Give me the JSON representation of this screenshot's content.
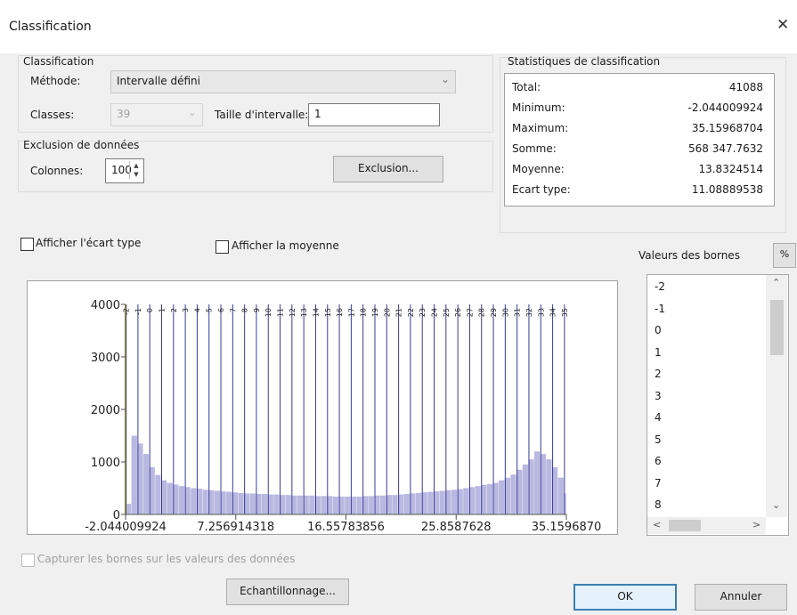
{
  "window": {
    "title": "Classification",
    "close": "✕"
  },
  "classification": {
    "group_label": "Classification",
    "method_label": "Méthode:",
    "method_value": "Intervalle défini",
    "classes_label": "Classes:",
    "classes_value": "39",
    "interval_label": "Taille d'intervalle:",
    "interval_value": "1"
  },
  "exclusion": {
    "group_label": "Exclusion de données",
    "columns_label": "Colonnes:",
    "columns_value": "100",
    "exclusion_button": "Exclusion..."
  },
  "stats": {
    "group_label": "Statistiques de classification",
    "rows": [
      {
        "label": "Total:",
        "value": "41088"
      },
      {
        "label": "Minimum:",
        "value": "-2.044009924"
      },
      {
        "label": "Maximum:",
        "value": "35.15968704"
      },
      {
        "label": "Somme:",
        "value": "568 347.7632"
      },
      {
        "label": "Moyenne:",
        "value": "13.8324514"
      },
      {
        "label": "Ecart type:",
        "value": "11.08889538"
      }
    ]
  },
  "options": {
    "show_std_label": "Afficher l'écart type",
    "show_std_checked": false,
    "show_mean_label": "Afficher la moyenne",
    "show_mean_checked": false,
    "snap_label": "Capturer les bornes sur les valeurs des données",
    "snap_checked": false
  },
  "breaks": {
    "header_label": "Valeurs des bornes",
    "percent_button": "%",
    "values": [
      "-2",
      "-1",
      "0",
      "1",
      "2",
      "3",
      "4",
      "5",
      "6",
      "7",
      "8"
    ]
  },
  "buttons": {
    "sampling": "Echantillonnage...",
    "ok": "OK",
    "cancel": "Annuler"
  },
  "colors": {
    "histogram": "#b8b8e0",
    "break_line": "#3a3a9a",
    "min_line": "#e8e890"
  },
  "chart_data": {
    "type": "bar",
    "title": "",
    "xlabel": "",
    "ylabel": "",
    "ylim": [
      0,
      4000
    ],
    "xlim": [
      -2.044009924,
      35.15968704
    ],
    "y_ticks": [
      "4000",
      "3000",
      "2000",
      "1000",
      "0"
    ],
    "x_ticks": [
      "-2.044009924",
      "7.256914318",
      "16.55783856",
      "25.8587628",
      "35.1596870"
    ],
    "break_values": [
      -2,
      -1,
      0,
      1,
      2,
      3,
      4,
      5,
      6,
      7,
      8,
      9,
      10,
      11,
      12,
      13,
      14,
      15,
      16,
      17,
      18,
      19,
      20,
      21,
      22,
      23,
      24,
      25,
      26,
      27,
      28,
      29,
      30,
      31,
      32,
      33,
      34,
      35
    ],
    "break_labels": [
      "-2",
      "-1",
      "0",
      "1",
      "2",
      "3",
      "4",
      "5",
      "6",
      "7",
      "8",
      "9",
      "10",
      "11",
      "12",
      "13",
      "14",
      "15",
      "16",
      "17",
      "18",
      "19",
      "20",
      "21",
      "22",
      "23",
      "24",
      "25",
      "26",
      "27",
      "28",
      "29",
      "30",
      "31",
      "32",
      "33",
      "34",
      "35"
    ],
    "bin_width": 0.5,
    "bin_counts": [
      200,
      1500,
      1350,
      1150,
      900,
      750,
      650,
      600,
      570,
      540,
      520,
      500,
      490,
      470,
      460,
      450,
      440,
      430,
      420,
      410,
      400,
      400,
      390,
      390,
      380,
      380,
      370,
      370,
      360,
      360,
      360,
      360,
      350,
      350,
      350,
      340,
      340,
      340,
      340,
      340,
      350,
      350,
      360,
      360,
      370,
      370,
      380,
      390,
      400,
      410,
      420,
      430,
      440,
      450,
      460,
      470,
      480,
      500,
      520,
      540,
      560,
      580,
      600,
      650,
      700,
      760,
      850,
      950,
      1050,
      1200,
      1150,
      1050,
      900,
      700,
      400
    ]
  }
}
